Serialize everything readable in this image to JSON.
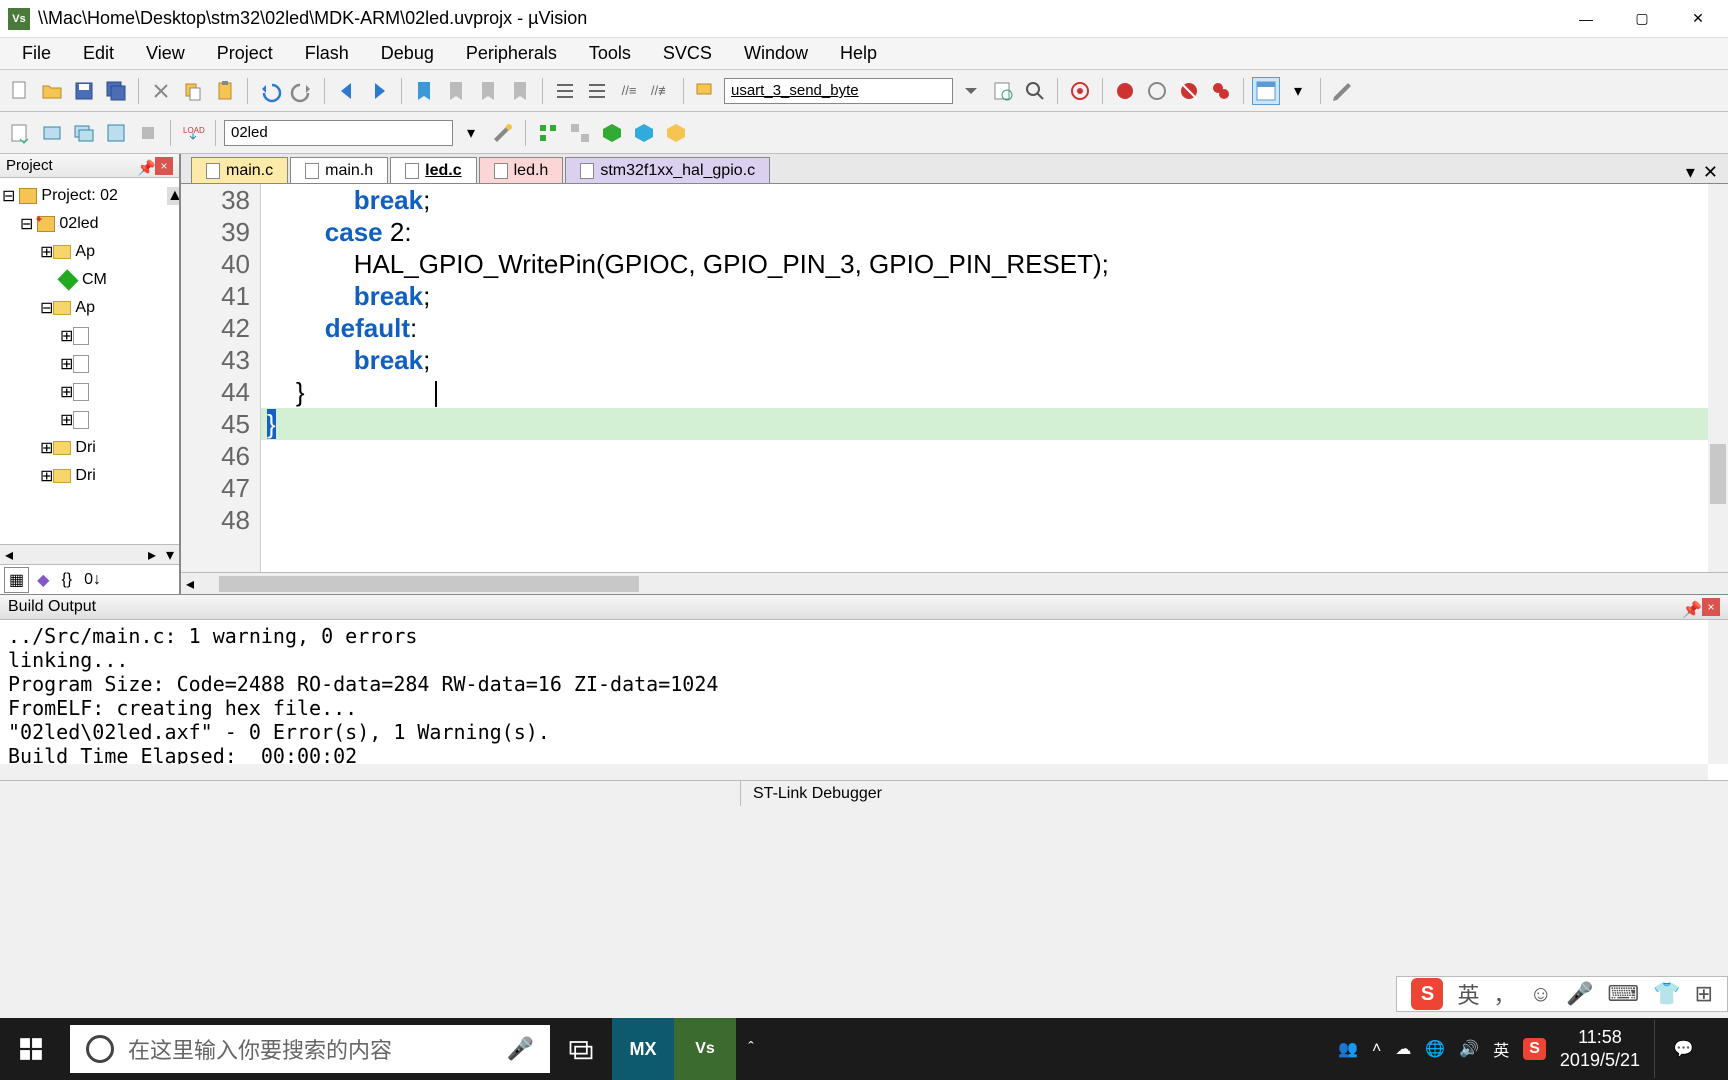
{
  "window": {
    "title": "\\\\Mac\\Home\\Desktop\\stm32\\02led\\MDK-ARM\\02led.uvprojx - µVision",
    "logo": "Vs"
  },
  "menu": [
    "File",
    "Edit",
    "View",
    "Project",
    "Flash",
    "Debug",
    "Peripherals",
    "Tools",
    "SVCS",
    "Window",
    "Help"
  ],
  "toolbar1": {
    "combo_value": "usart_3_send_byte"
  },
  "toolbar2": {
    "target": "02led"
  },
  "project_panel": {
    "title": "Project",
    "root": "Project: 02",
    "target": "02led",
    "groups": [
      "Ap",
      "CM",
      "Ap",
      "Dri",
      "Dri"
    ]
  },
  "editor": {
    "tabs": [
      "main.c",
      "main.h",
      "led.c",
      "led.h",
      "stm32f1xx_hal_gpio.c"
    ],
    "active_tab": "led.c",
    "gutter": [
      "38",
      "39",
      "40",
      "41",
      "42",
      "43",
      "44",
      "45",
      "46",
      "47",
      "48"
    ],
    "lines": [
      {
        "indent": "            ",
        "tokens": [
          {
            "t": "break",
            "c": "kw"
          },
          {
            "t": ";",
            "c": ""
          }
        ]
      },
      {
        "indent": "        ",
        "tokens": [
          {
            "t": "case",
            "c": "kw"
          },
          {
            "t": " 2:",
            "c": "num"
          }
        ]
      },
      {
        "indent": "            ",
        "tokens": [
          {
            "t": "HAL_GPIO_WritePin(GPIOC, GPIO_PIN_3, GPIO_PIN_RESET);",
            "c": "fn"
          }
        ]
      },
      {
        "indent": "            ",
        "tokens": [
          {
            "t": "break",
            "c": "kw"
          },
          {
            "t": ";",
            "c": ""
          }
        ]
      },
      {
        "indent": "        ",
        "tokens": [
          {
            "t": "default",
            "c": "kw"
          },
          {
            "t": ":",
            "c": ""
          }
        ]
      },
      {
        "indent": "            ",
        "tokens": [
          {
            "t": "break",
            "c": "kw"
          },
          {
            "t": ";",
            "c": ""
          }
        ]
      },
      {
        "indent": "    ",
        "tokens": [
          {
            "t": "}",
            "c": ""
          }
        ]
      },
      {
        "indent": "",
        "tokens": [
          {
            "t": "}",
            "c": ""
          }
        ],
        "hl": true,
        "sel": true
      },
      {
        "indent": "",
        "tokens": []
      },
      {
        "indent": "",
        "tokens": []
      },
      {
        "indent": "",
        "tokens": []
      }
    ],
    "cursor_line": 7
  },
  "build": {
    "title": "Build Output",
    "lines": [
      "../Src/main.c: 1 warning, 0 errors",
      "linking...",
      "Program Size: Code=2488 RO-data=284 RW-data=16 ZI-data=1024",
      "FromELF: creating hex file...",
      "\"02led\\02led.axf\" - 0 Error(s), 1 Warning(s).",
      "Build Time Elapsed:  00:00:02"
    ]
  },
  "status": {
    "debugger": "ST-Link Debugger"
  },
  "ime": {
    "lang": "英",
    "sogou": "S"
  },
  "taskbar": {
    "search_placeholder": "在这里输入你要搜索的内容",
    "time": "11:58",
    "date": "2019/5/21",
    "lang": "英",
    "sogou": "S"
  }
}
